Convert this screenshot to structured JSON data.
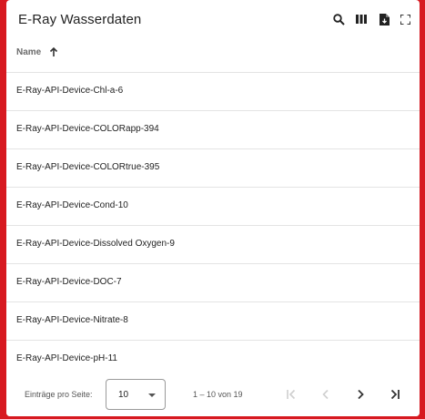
{
  "toolbar": {
    "title": "E-Ray Wasserdaten",
    "icons": [
      "search-icon",
      "view-column-icon",
      "file-download-icon",
      "fullscreen-icon"
    ]
  },
  "table": {
    "column_header": "Name",
    "sort_direction": "ascending",
    "rows": [
      "E-Ray-API-Device-Chl-a-6",
      "E-Ray-API-Device-COLORapp-394",
      "E-Ray-API-Device-COLORtrue-395",
      "E-Ray-API-Device-Cond-10",
      "E-Ray-API-Device-Dissolved Oxygen-9",
      "E-Ray-API-Device-DOC-7",
      "E-Ray-API-Device-Nitrate-8",
      "E-Ray-API-Device-pH-11"
    ]
  },
  "pagination": {
    "rows_per_page_label": "Einträge pro Seite:",
    "rows_per_page_value": "10",
    "range_text": "1 – 10 von 19"
  },
  "colors": {
    "frame": "#d71920",
    "row_border": "#e4e4e4"
  }
}
